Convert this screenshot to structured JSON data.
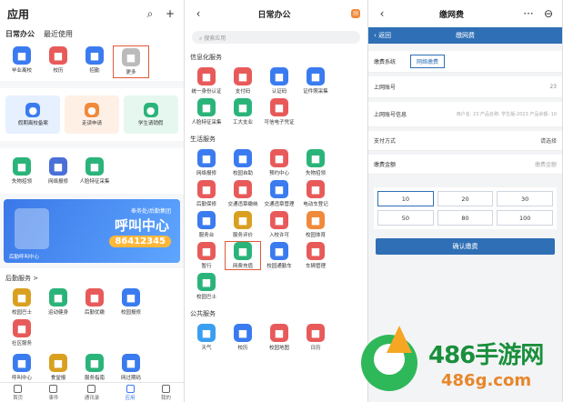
{
  "panel1": {
    "title": "应用",
    "tabs": [
      "日常办公",
      "最近使用"
    ],
    "row1": [
      {
        "label": "毕业离校",
        "color": "#3a7bf0"
      },
      {
        "label": "校历",
        "color": "#e85a5a"
      },
      {
        "label": "招勤",
        "color": "#3a7bf0"
      },
      {
        "label": "更多",
        "color": "#bbbbbb"
      }
    ],
    "big_cards": [
      {
        "label": "假期离校备案",
        "bg": "#e6f0ff",
        "color": "#3a7bf0"
      },
      {
        "label": "走读申请",
        "bg": "#fff0e6",
        "color": "#f08a3a"
      },
      {
        "label": "学生请销假",
        "bg": "#e6f7f0",
        "color": "#2bb47a"
      }
    ],
    "row2": [
      {
        "label": "失物招领",
        "color": "#2bb47a"
      },
      {
        "label": "网络报修",
        "color": "#4a6fd8"
      },
      {
        "label": "人脸特征采集",
        "color": "#2bb47a"
      }
    ],
    "banner": {
      "small": "奉务处/后勤集团",
      "big": "呼叫中心",
      "num": "86412345",
      "foot": "后勤呼叫中心"
    },
    "section": "后勤服务 >",
    "row3": [
      {
        "label": "校园巴士",
        "color": "#d9a020"
      },
      {
        "label": "运动健身",
        "color": "#2bb47a"
      },
      {
        "label": "后勤优缴",
        "color": "#e85a5a"
      },
      {
        "label": "校园报修",
        "color": "#3a7bf0"
      },
      {
        "label": "社区服务",
        "color": "#e85a5a"
      }
    ],
    "row4": [
      {
        "label": "呼叫中心",
        "color": "#3a7bf0"
      },
      {
        "label": "食堂报",
        "color": "#d9a020"
      },
      {
        "label": "服务指南",
        "color": "#2bb47a"
      },
      {
        "label": "网过期码",
        "color": "#3a7bf0"
      },
      {
        "label": "服务评价",
        "color": "#d9a020"
      }
    ],
    "nav": [
      "首页",
      "事件",
      "通讯录",
      "应用",
      "我的"
    ]
  },
  "panel2": {
    "title": "日常办公",
    "search_placeholder": "搜索应用",
    "sections": [
      {
        "title": "信息化服务",
        "items": [
          {
            "label": "统一身份认证",
            "color": "#e85a5a"
          },
          {
            "label": "支付码",
            "color": "#e85a5a"
          },
          {
            "label": "认证码",
            "color": "#3a7bf0"
          },
          {
            "label": "证件照采集",
            "color": "#3a7bf0"
          },
          {
            "label": "人脸特征采集",
            "color": "#2bb47a"
          },
          {
            "label": "工大支业",
            "color": "#2bb47a"
          },
          {
            "label": "可信电子凭证",
            "color": "#e85a5a"
          }
        ]
      },
      {
        "title": "生活服务",
        "items": [
          {
            "label": "网络报修",
            "color": "#3a7bf0"
          },
          {
            "label": "校园自助",
            "color": "#3a7bf0"
          },
          {
            "label": "预约中心",
            "color": "#e85a5a"
          },
          {
            "label": "失物招领",
            "color": "#2bb47a"
          },
          {
            "label": "后勤保修",
            "color": "#e85a5a"
          },
          {
            "label": "交通违章缴纳",
            "color": "#e85a5a"
          },
          {
            "label": "交通违章管理",
            "color": "#3a7bf0"
          },
          {
            "label": "电动车登记",
            "color": "#e85a5a"
          },
          {
            "label": "服务台",
            "color": "#3a7bf0"
          },
          {
            "label": "服务评价",
            "color": "#d9a020"
          },
          {
            "label": "入校许可",
            "color": "#e85a5a"
          },
          {
            "label": "校园体育",
            "color": "#f08a3a"
          },
          {
            "label": "暂行",
            "color": "#e85a5a"
          },
          {
            "label": "网费充值",
            "color": "#2bb47a"
          },
          {
            "label": "校园通勤车",
            "color": "#3a7bf0"
          },
          {
            "label": "车辆管理",
            "color": "#e85a5a"
          },
          {
            "label": "校园巴士",
            "color": "#2bb47a"
          }
        ]
      },
      {
        "title": "公共服务",
        "items": [
          {
            "label": "天气",
            "color": "#3a9ff0"
          },
          {
            "label": "校历",
            "color": "#3a7bf0"
          },
          {
            "label": "校园地图",
            "color": "#e85a5a"
          },
          {
            "label": "日历",
            "color": "#e85a5a"
          }
        ]
      }
    ]
  },
  "panel3": {
    "title": "缴网费",
    "back": "返回",
    "bar_title": "缴网费",
    "system_label": "缴费系统",
    "system_value": "网络缴费",
    "account_label": "上网账号",
    "account_value": "23",
    "info_label": "上网账号信息",
    "info_value": "用户名: 23 产品名称: 学生版-2023 产品余额: 10",
    "pay_label": "支付方式",
    "pay_value": "请选择",
    "amount_label": "缴费金额",
    "amount_value": "缴费金额",
    "amounts": [
      "10",
      "20",
      "30",
      "50",
      "80",
      "100"
    ],
    "confirm": "确认缴费"
  },
  "watermark": {
    "brand": "486手游网",
    "url": "486g.com"
  }
}
